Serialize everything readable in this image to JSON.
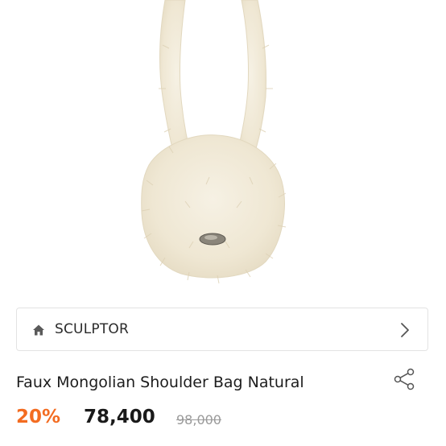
{
  "product_image": {
    "alt": "Faux Mongolian Shoulder Bag Natural"
  },
  "brand": {
    "name": "SCULPTOR",
    "icon": "home-icon",
    "chevron": "chevron-right-icon"
  },
  "product": {
    "title": "Faux Mongolian Shoulder Bag Natural",
    "share_icon": "share-icon"
  },
  "price": {
    "discount": "20%",
    "sale": "78,400",
    "original": "98,000"
  },
  "colors": {
    "discount": "#f36c21",
    "fur": "#f1ead9",
    "border": "#e3e3e3"
  }
}
